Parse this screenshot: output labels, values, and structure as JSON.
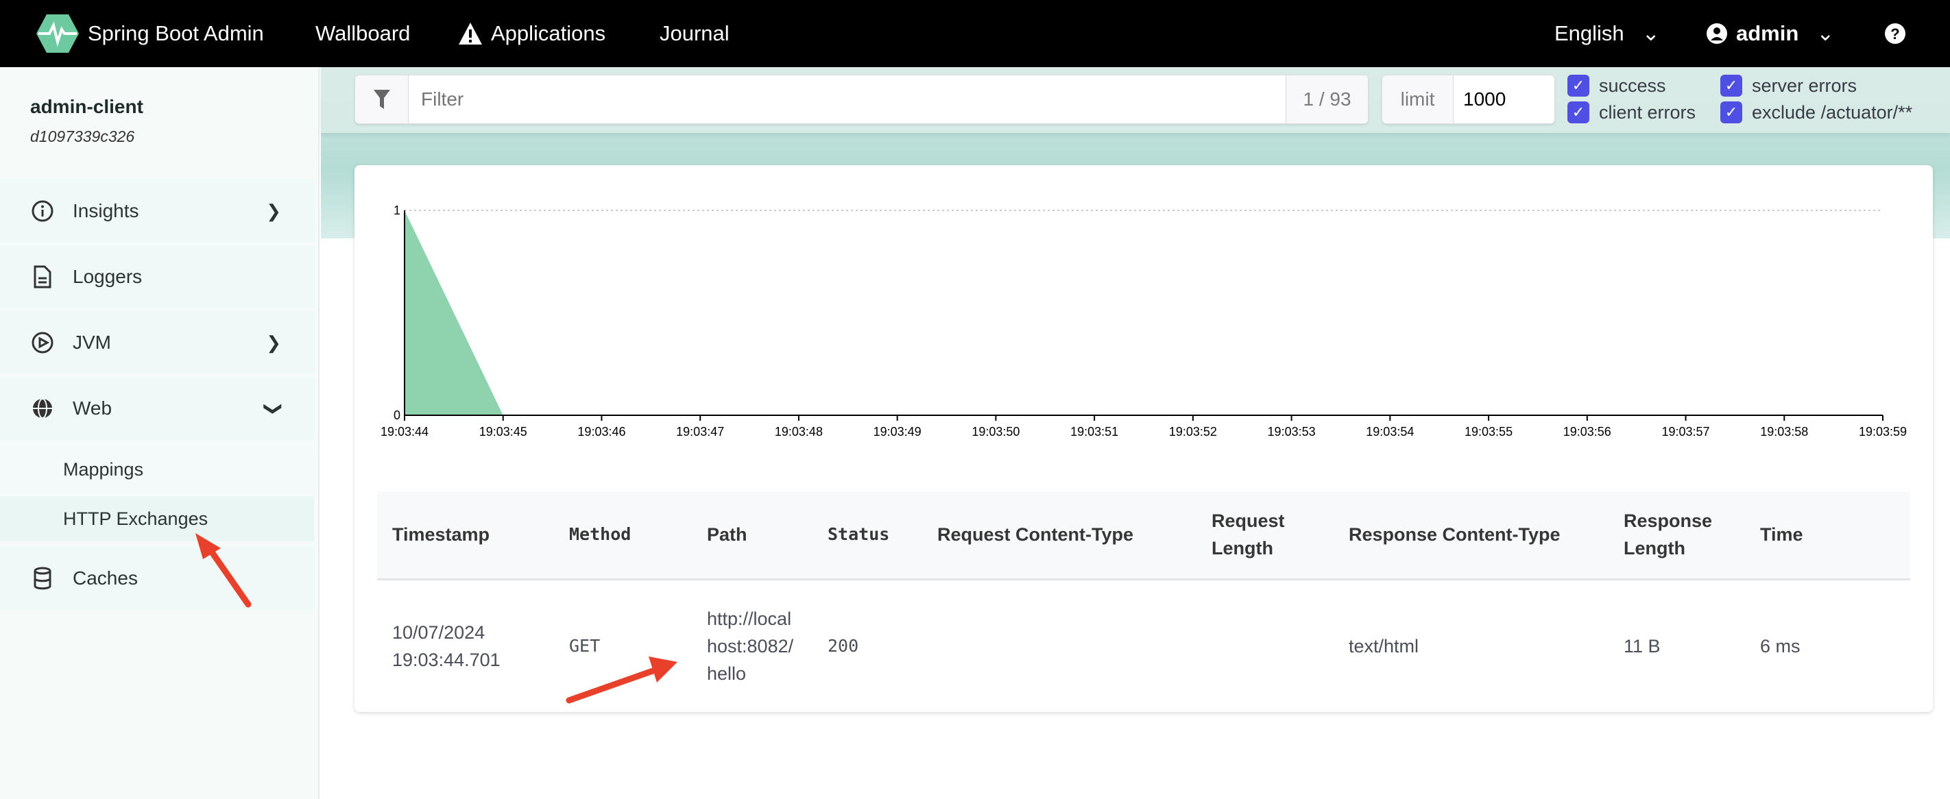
{
  "topbar": {
    "brand": "Spring Boot Admin",
    "wallboard": "Wallboard",
    "applications": "Applications",
    "journal": "Journal",
    "language": "English",
    "user": "admin"
  },
  "sidebar": {
    "app_name": "admin-client",
    "instance_id": "d1097339c326",
    "items": [
      {
        "label": "Insights"
      },
      {
        "label": "Loggers"
      },
      {
        "label": "JVM"
      },
      {
        "label": "Web"
      },
      {
        "label": "Mappings"
      },
      {
        "label": "HTTP Exchanges"
      },
      {
        "label": "Caches"
      }
    ]
  },
  "filter": {
    "placeholder": "Filter",
    "count": "1 / 93",
    "limit_label": "limit",
    "limit_value": "1000",
    "checkboxes": [
      {
        "label": "success",
        "checked": true
      },
      {
        "label": "client errors",
        "checked": true
      },
      {
        "label": "server errors",
        "checked": true
      },
      {
        "label": "exclude /actuator/**",
        "checked": true
      }
    ]
  },
  "chart_data": {
    "type": "area",
    "x": [
      "19:03:44",
      "19:03:45",
      "19:03:46",
      "19:03:47",
      "19:03:48",
      "19:03:49",
      "19:03:50",
      "19:03:51",
      "19:03:52",
      "19:03:53",
      "19:03:54",
      "19:03:55",
      "19:03:56",
      "19:03:57",
      "19:03:58",
      "19:03:59"
    ],
    "values": [
      1,
      0,
      0,
      0,
      0,
      0,
      0,
      0,
      0,
      0,
      0,
      0,
      0,
      0,
      0,
      0
    ],
    "ylim": [
      0,
      1
    ],
    "yticks": [
      "0",
      "1"
    ],
    "color": "#8fd3ae"
  },
  "table": {
    "headers": [
      "Timestamp",
      "Method",
      "Path",
      "Status",
      "Request Content-Type",
      "Request Length",
      "Response Content-Type",
      "Response Length",
      "Time"
    ],
    "rows": [
      {
        "timestamp": "10/07/2024 19:03:44.701",
        "method": "GET",
        "path": "http://localhost:8082/hello",
        "status": "200",
        "request_content_type": "",
        "request_length": "",
        "response_content_type": "text/html",
        "response_length": "11 B",
        "time": "6 ms"
      }
    ]
  }
}
